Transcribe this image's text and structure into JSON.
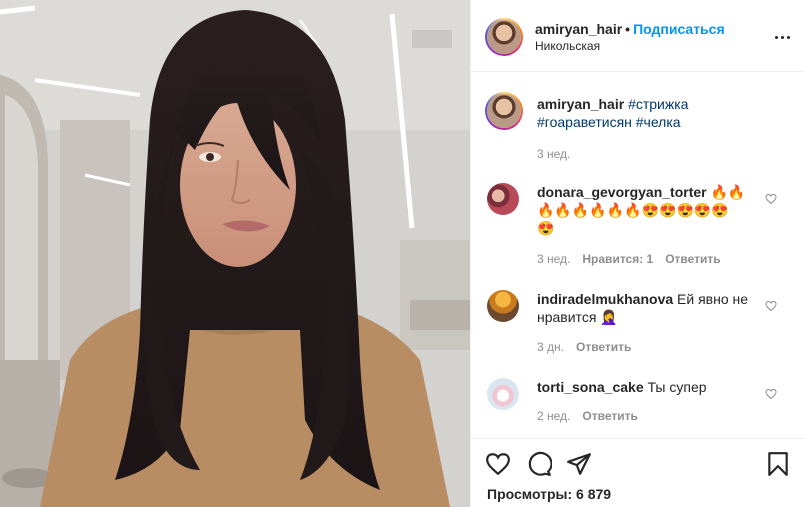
{
  "post": {
    "username": "amiryan_hair",
    "separator": "•",
    "follow_label": "Подписаться",
    "location": "Никольская"
  },
  "caption": {
    "username": "amiryan_hair",
    "tags": "#стрижка",
    "tags2": "#гоараветисян #челка",
    "time": "3 нед."
  },
  "comments": [
    {
      "username": "donara_gevorgyan_torter",
      "text_line1": "🔥🔥",
      "text_line2": "🔥🔥🔥🔥🔥🔥😍😍😍😍😍",
      "text_line3": "😍",
      "time": "3 нед.",
      "likes": "Нравится: 1",
      "reply": "Ответить"
    },
    {
      "username": "indiradelmukhanova",
      "text": "Ей явно не",
      "text_line2": "нравится 🤦‍♀️",
      "time": "3 дн.",
      "reply": "Ответить"
    },
    {
      "username": "torti_sona_cake",
      "text": "Ты супер",
      "time": "2 нед.",
      "reply": "Ответить"
    }
  ],
  "footer": {
    "views_label": "Просмотры: 6 879"
  },
  "icons": {
    "more": "more-options-icon",
    "like": "heart-icon",
    "comment": "comment-icon",
    "share": "share-icon",
    "save": "bookmark-icon"
  }
}
